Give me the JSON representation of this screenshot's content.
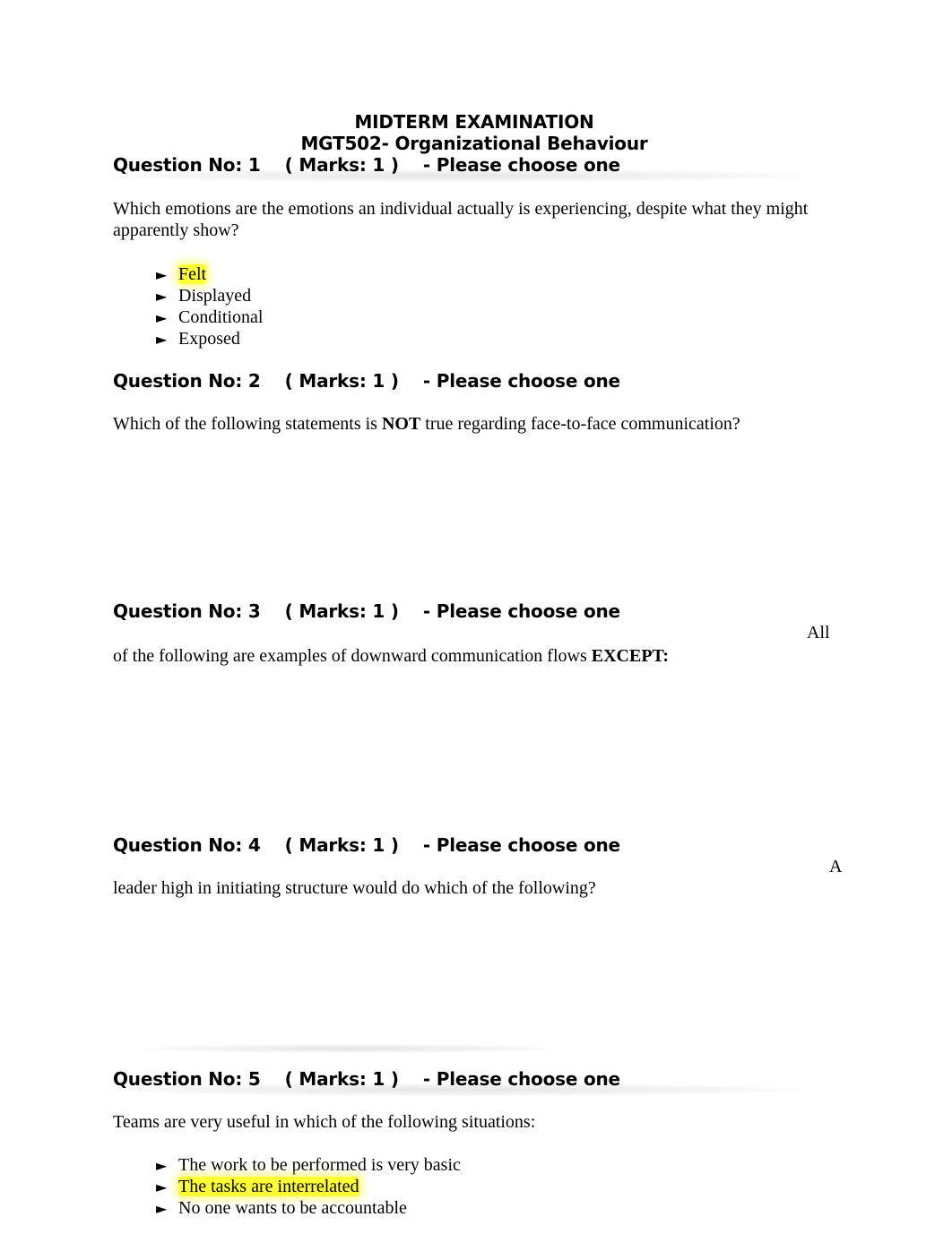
{
  "document": {
    "title": "MIDTERM  EXAMINATION",
    "subtitle": "MGT502- Organizational Behaviour"
  },
  "colors": {
    "highlight": "#ffff33"
  },
  "questions": [
    {
      "heading": "Question No: 1    ( Marks: 1 )    - Please choose one",
      "text": "Which emotions are the emotions an individual actually is experiencing, despite what they might apparently show?",
      "options": [
        {
          "label": "Felt",
          "highlighted": true
        },
        {
          "label": "Displayed",
          "highlighted": false
        },
        {
          "label": "Conditional",
          "highlighted": false
        },
        {
          "label": "Exposed",
          "highlighted": false
        }
      ]
    },
    {
      "heading": "Question No: 2    ( Marks: 1 )    - Please choose one",
      "text_before": "Which of the following statements is ",
      "text_bold": "NOT",
      "text_after": " true regarding face-to-face communication?"
    },
    {
      "heading": "Question No: 3    ( Marks: 1 )    - Please choose one",
      "floating_word": "All",
      "text_before": "of the following are examples of downward communication flows ",
      "text_bold": "EXCEPT:"
    },
    {
      "heading": "Question No: 4    ( Marks: 1 )    - Please choose one",
      "floating_word": "A",
      "text": "leader high in initiating structure would do which of the following?"
    },
    {
      "heading": "Question No: 5    ( Marks: 1 )    - Please choose one",
      "text": "Teams are very useful in which of the following situations:",
      "options": [
        {
          "label": "The work to be performed is very basic",
          "highlighted": false
        },
        {
          "label": "The tasks are interrelated",
          "highlighted": true
        },
        {
          "label": "No one wants to be accountable",
          "highlighted": false
        }
      ]
    }
  ],
  "icons": {
    "bullet": "►"
  }
}
